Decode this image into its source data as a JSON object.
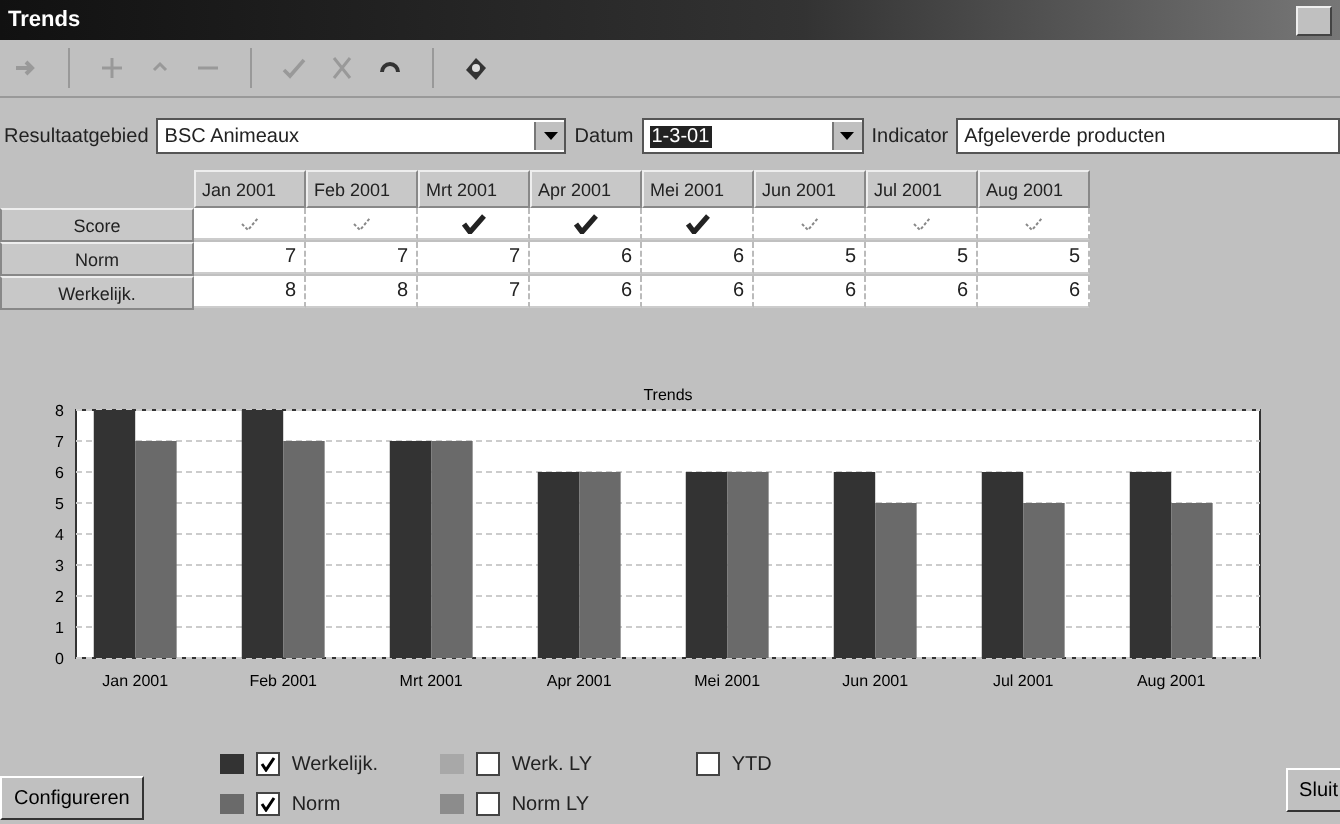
{
  "window": {
    "title": "Trends"
  },
  "filters": {
    "area_label": "Resultaatgebied",
    "area_value": "BSC Animeaux",
    "date_label": "Datum",
    "date_value": "1-3-01",
    "indicator_label": "Indicator",
    "indicator_value": "Afgeleverde producten"
  },
  "table": {
    "columns": [
      "Jan 2001",
      "Feb 2001",
      "Mrt 2001",
      "Apr 2001",
      "Mei 2001",
      "Jun 2001",
      "Jul 2001",
      "Aug 2001"
    ],
    "score_label": "Score",
    "scores": [
      {
        "achieved": false
      },
      {
        "achieved": false
      },
      {
        "achieved": true
      },
      {
        "achieved": true
      },
      {
        "achieved": true
      },
      {
        "achieved": false
      },
      {
        "achieved": false
      },
      {
        "achieved": false
      }
    ],
    "rows": [
      {
        "label": "Norm",
        "values": [
          "7",
          "7",
          "7",
          "6",
          "6",
          "5",
          "5",
          "5"
        ]
      },
      {
        "label": "Werkelijk.",
        "values": [
          "8",
          "8",
          "7",
          "6",
          "6",
          "6",
          "6",
          "6"
        ]
      }
    ]
  },
  "chart": {
    "chart_data": {
      "type": "bar",
      "title": "Trends",
      "categories": [
        "Jan 2001",
        "Feb 2001",
        "Mrt 2001",
        "Apr 2001",
        "Mei 2001",
        "Jun 2001",
        "Jul 2001",
        "Aug 2001"
      ],
      "series": [
        {
          "name": "Werkelijk.",
          "color": "#333333",
          "values": [
            8,
            8,
            7,
            6,
            6,
            6,
            6,
            6
          ]
        },
        {
          "name": "Norm",
          "color": "#6a6a6a",
          "values": [
            7,
            7,
            7,
            6,
            6,
            5,
            5,
            5
          ]
        }
      ],
      "ylim": [
        0,
        8
      ],
      "yticks": [
        0,
        1,
        2,
        3,
        4,
        5,
        6,
        7,
        8
      ],
      "grid": true
    }
  },
  "legend": [
    {
      "kind": "series",
      "checked": true
    },
    {
      "kind": "extra",
      "label": "Werk. LY",
      "color": "#a8a8a8",
      "checked": false
    },
    {
      "kind": "extra",
      "label": "YTD",
      "checked": false
    },
    {
      "kind": "series",
      "checked": true
    },
    {
      "kind": "extra",
      "label": "Norm LY",
      "color": "#8c8c8c",
      "checked": false
    }
  ],
  "buttons": {
    "configure": "Configureren",
    "close": "Sluit"
  }
}
